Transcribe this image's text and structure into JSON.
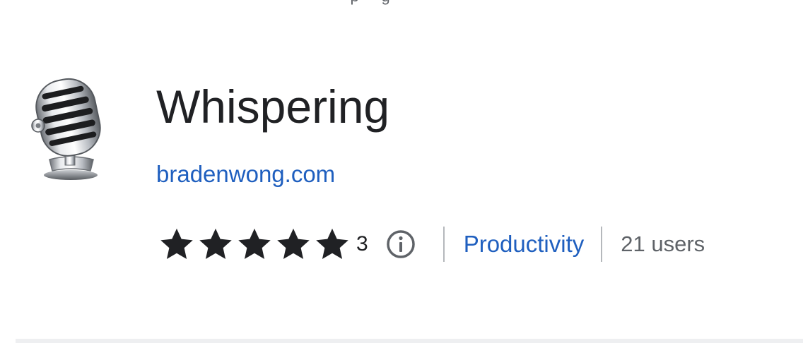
{
  "top_clipped_text": "· p ·· g ·",
  "extension": {
    "icon": "microphone-icon",
    "name": "Whispering",
    "publisher": "bradenwong.com",
    "rating": {
      "stars": 5,
      "count": "3"
    },
    "info_icon": "info-icon",
    "category": "Productivity",
    "users": "21 users"
  },
  "colors": {
    "title": "#202124",
    "link": "#1f5fbf",
    "muted": "#5f6368",
    "star": "#202124",
    "divider": "#b5b8bc"
  }
}
